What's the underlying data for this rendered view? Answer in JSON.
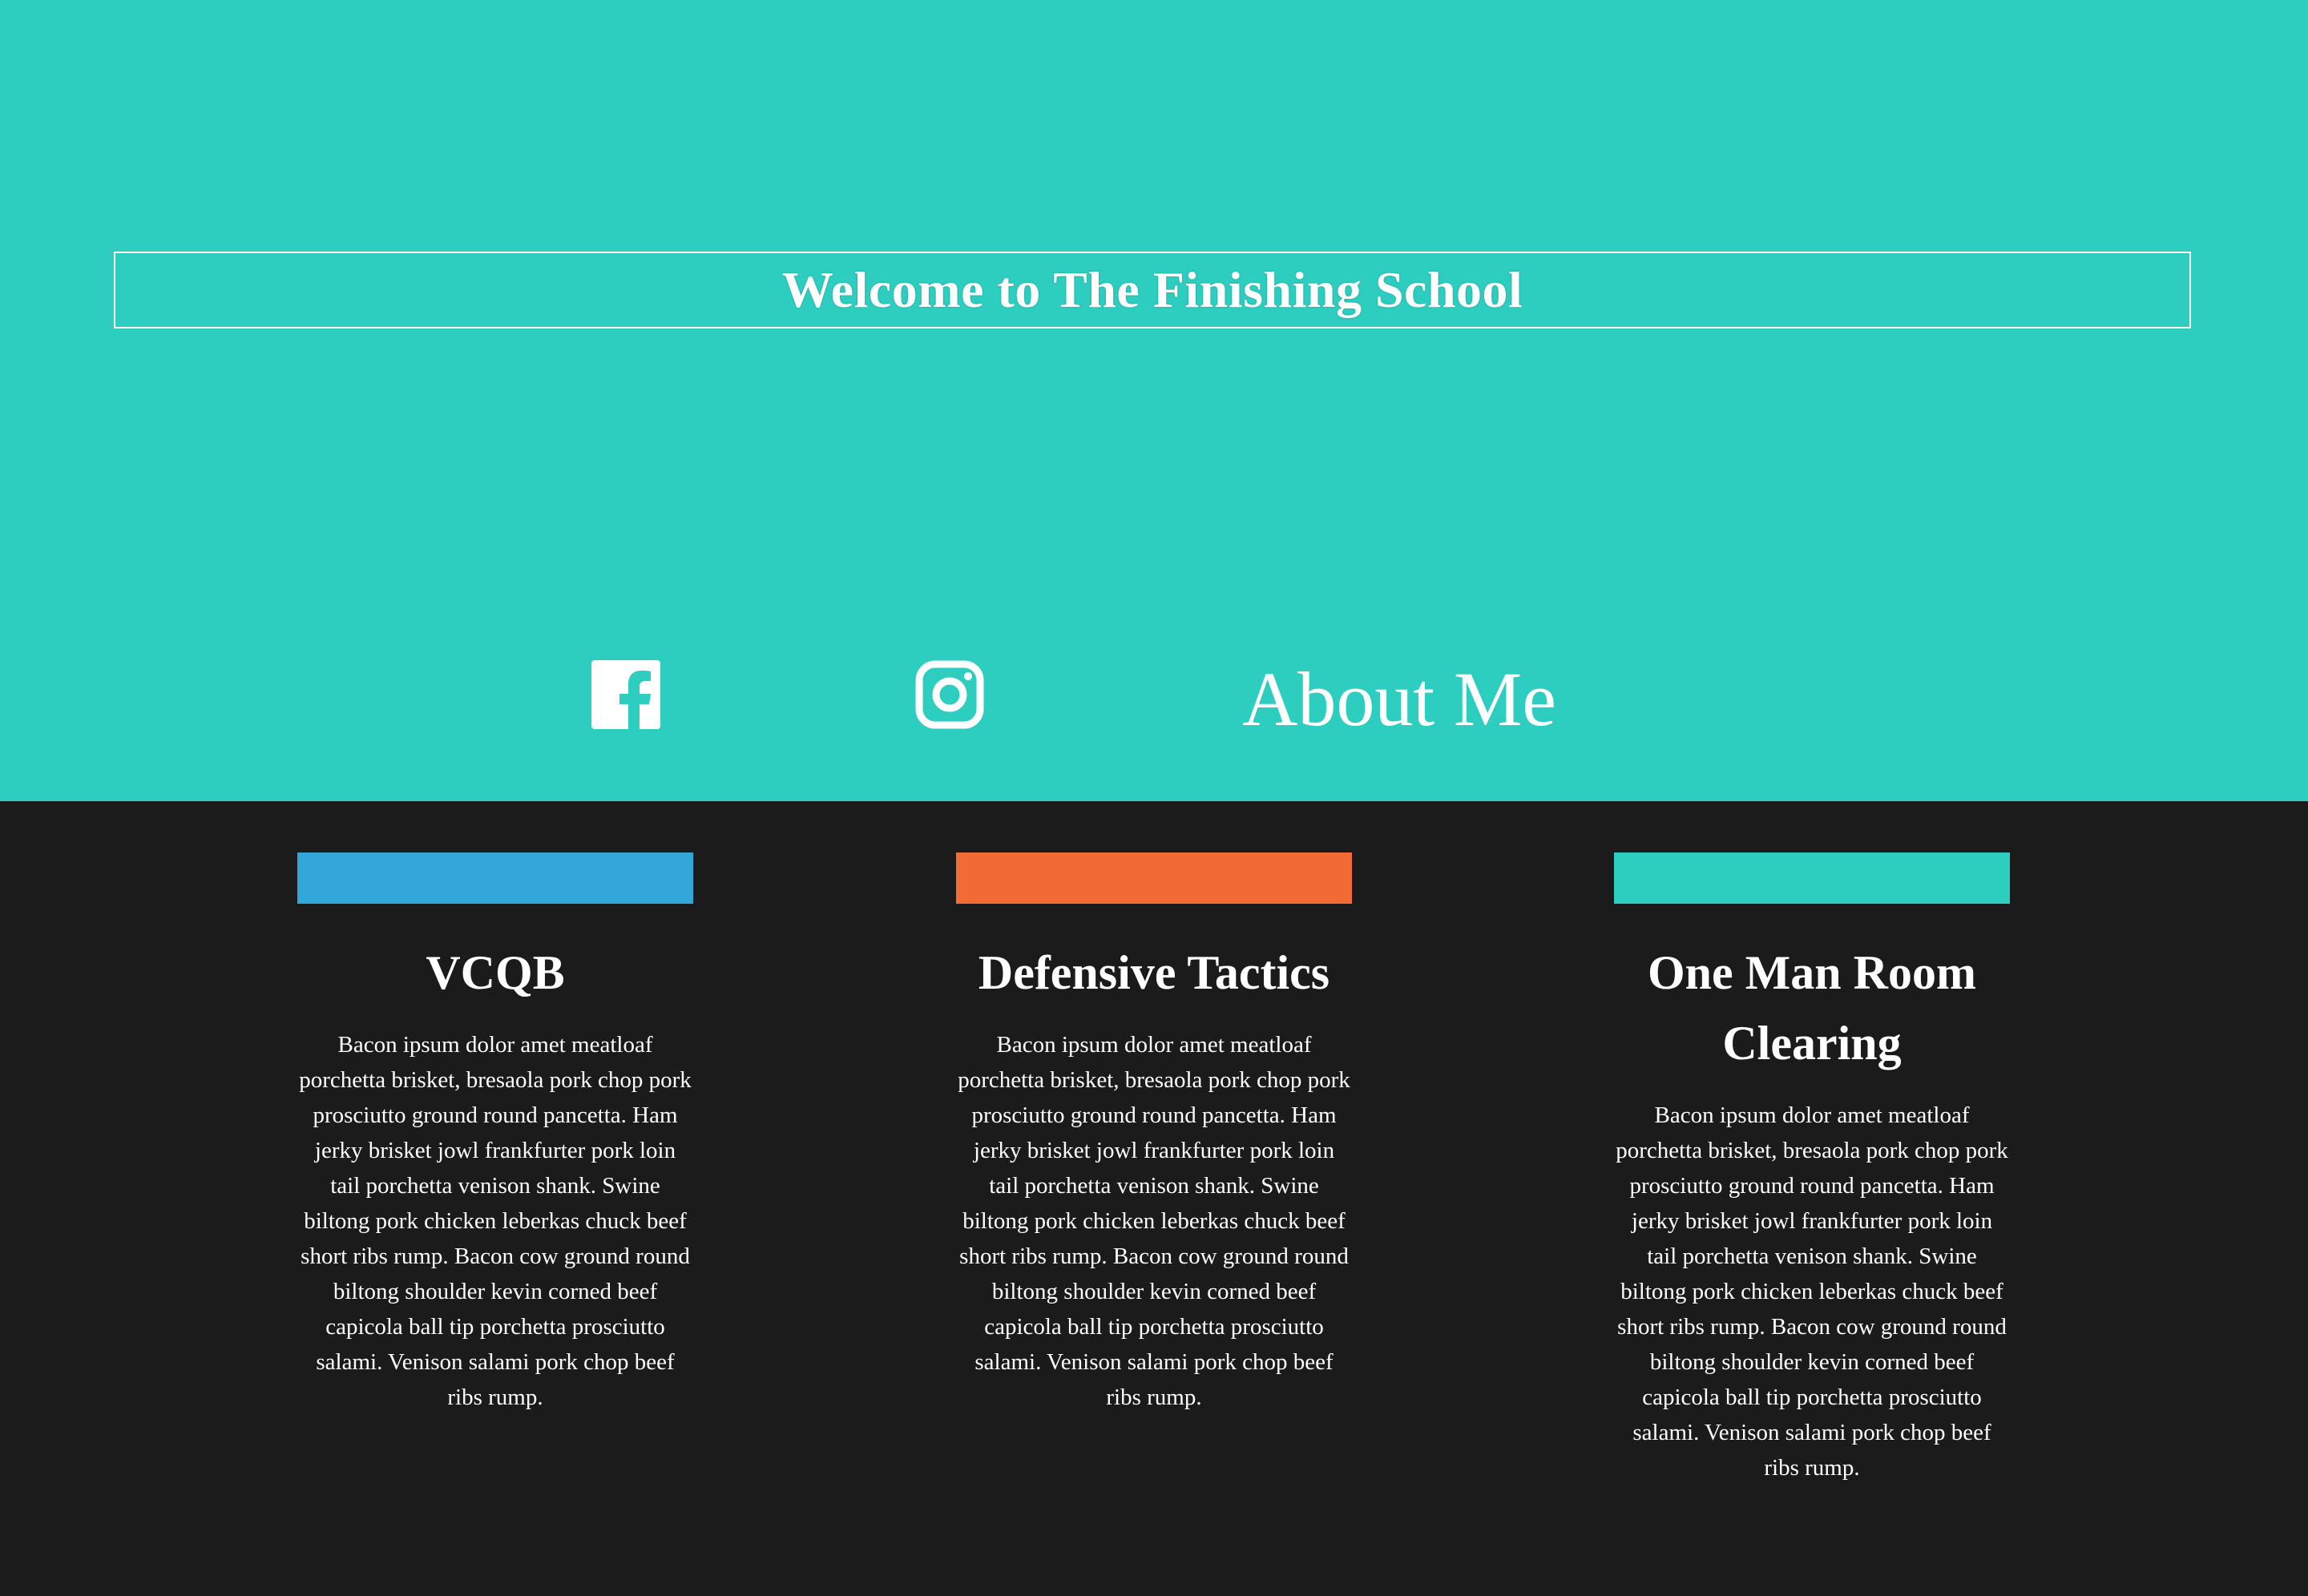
{
  "hero": {
    "title": "Welcome to The Finishing School",
    "background_color": "#2dcdc0"
  },
  "nav": {
    "facebook_icon": "facebook-icon",
    "instagram_icon": "instagram-icon",
    "about_label": "About Me"
  },
  "cards": [
    {
      "title": "VCQB",
      "bar_color": "#33a7da",
      "body": "Bacon ipsum dolor amet meatloaf porchetta brisket, bresaola pork chop pork prosciutto ground round pancetta. Ham jerky brisket jowl frankfurter pork loin tail porchetta venison shank. Swine biltong pork chicken leberkas chuck beef short ribs rump. Bacon cow ground round biltong shoulder kevin corned beef capicola ball tip porchetta prosciutto salami. Venison salami pork chop beef ribs rump."
    },
    {
      "title": "Defensive Tactics",
      "bar_color": "#f26b35",
      "body": "Bacon ipsum dolor amet meatloaf porchetta brisket, bresaola pork chop pork prosciutto ground round pancetta. Ham jerky brisket jowl frankfurter pork loin tail porchetta venison shank. Swine biltong pork chicken leberkas chuck beef short ribs rump. Bacon cow ground round biltong shoulder kevin corned beef capicola ball tip porchetta prosciutto salami. Venison salami pork chop beef ribs rump."
    },
    {
      "title": "One Man Room Clearing",
      "bar_color": "#2dcdc0",
      "body": "Bacon ipsum dolor amet meatloaf porchetta brisket, bresaola pork chop pork prosciutto ground round pancetta. Ham jerky brisket jowl frankfurter pork loin tail porchetta venison shank. Swine biltong pork chicken leberkas chuck beef short ribs rump. Bacon cow ground round biltong shoulder kevin corned beef capicola ball tip porchetta prosciutto salami. Venison salami pork chop beef ribs rump."
    }
  ],
  "colors": {
    "dark_background": "#1b1b1c",
    "text": "#ffffff"
  }
}
